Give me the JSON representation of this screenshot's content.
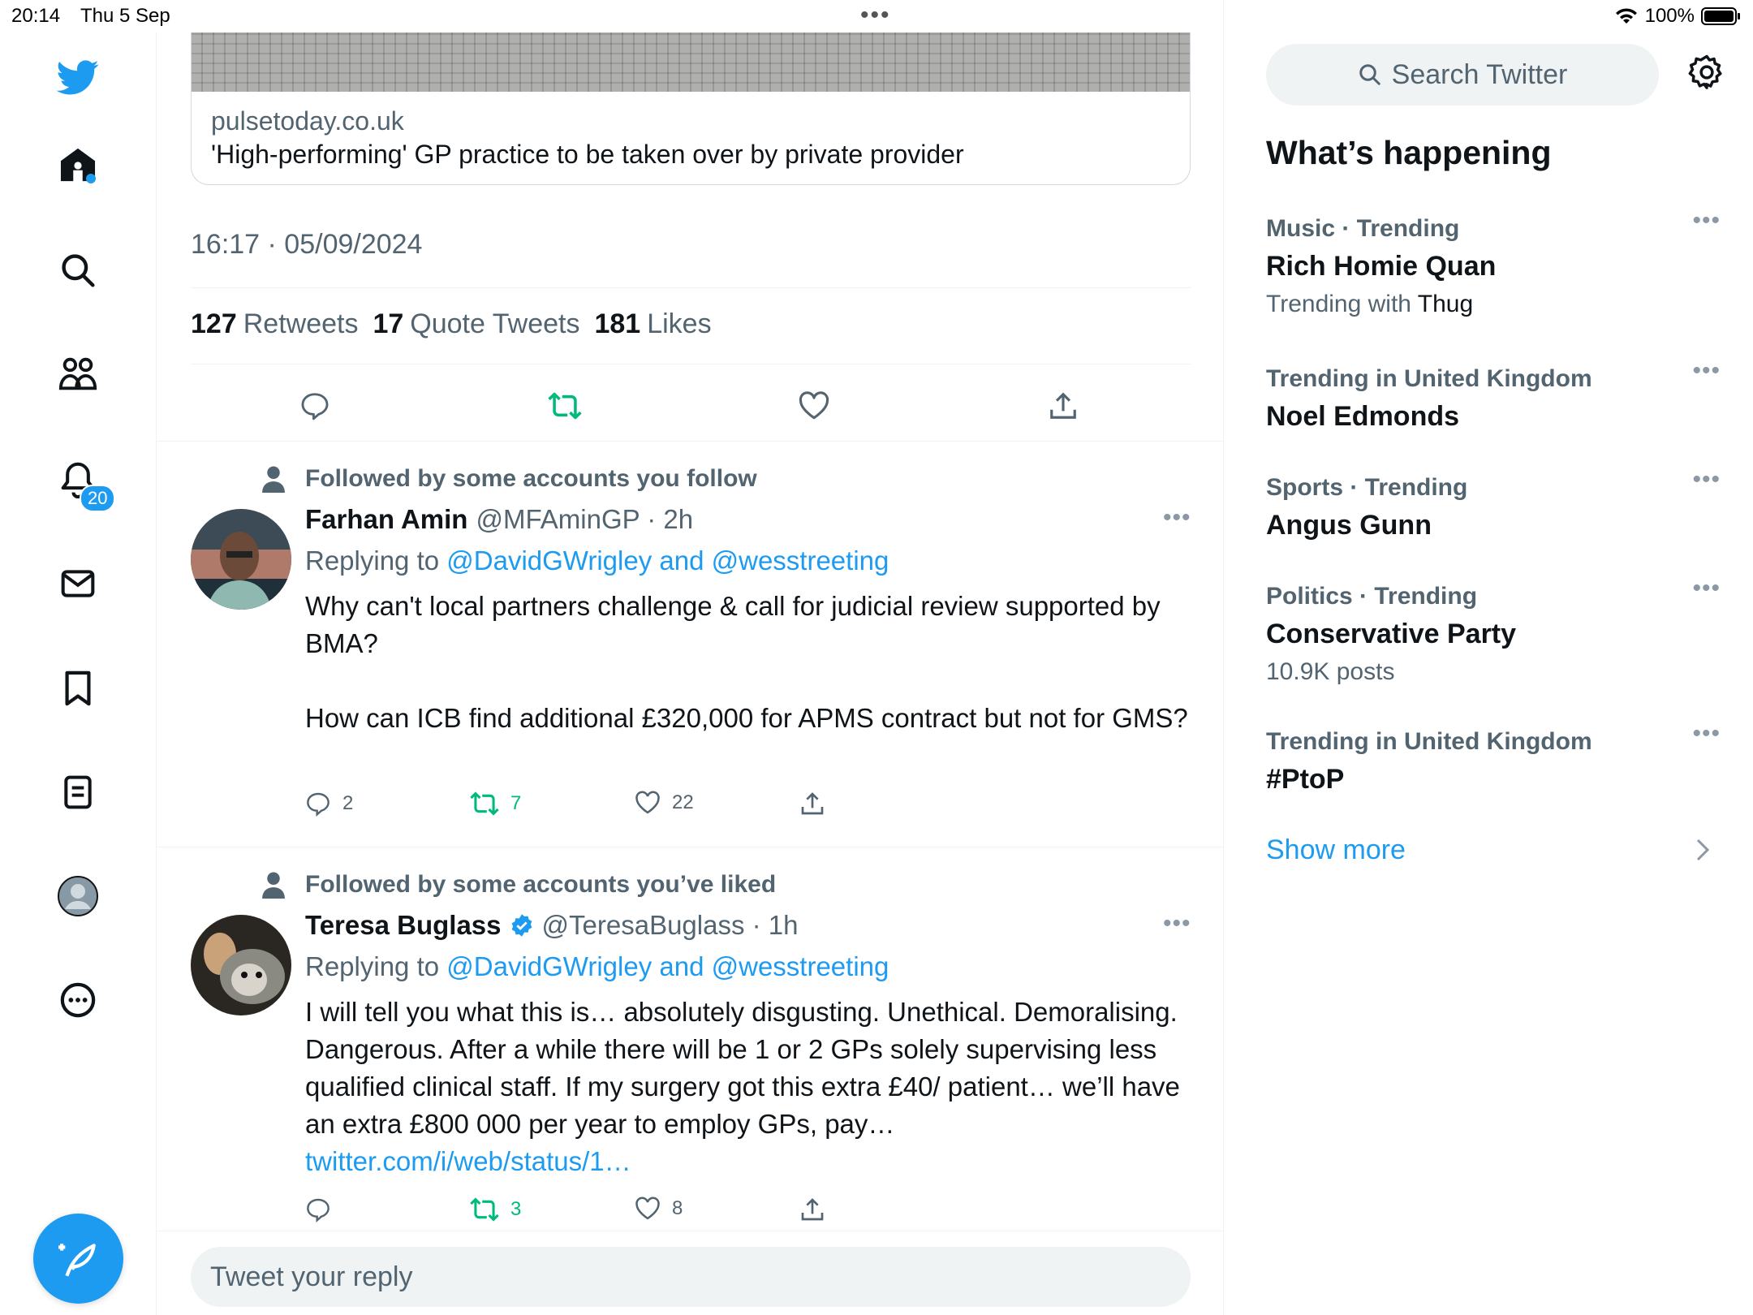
{
  "status_bar": {
    "time": "20:14",
    "date": "Thu 5 Sep",
    "battery": "100%"
  },
  "nav": {
    "notification_count": "20"
  },
  "tweet": {
    "card_domain": "pulsetoday.co.uk",
    "card_title": "'High-performing' GP practice to be taken over by private provider",
    "timestamp": "16:17 · 05/09/2024",
    "retweets_count": "127",
    "retweets_label": "Retweets",
    "quotes_count": "17",
    "quotes_label": "Quote Tweets",
    "likes_count": "181",
    "likes_label": "Likes"
  },
  "replies": [
    {
      "social_context": "Followed by some accounts you follow",
      "name": "Farhan Amin",
      "handle": "@MFAminGP · 2h",
      "replying_prefix": "Replying to ",
      "replying_to": "@DavidGWrigley and @wesstreeting",
      "text_p1": "Why can't local partners challenge & call for judicial review supported by BMA?",
      "text_p2": "How can ICB find additional £320,000 for APMS contract but not for GMS?",
      "replies": "2",
      "retweets": "7",
      "likes": "22"
    },
    {
      "social_context": "Followed by some accounts you’ve liked",
      "name": "Teresa Buglass",
      "handle": "@TeresaBuglass · 1h",
      "replying_prefix": "Replying to ",
      "replying_to": "@DavidGWrigley and @wesstreeting",
      "text": "I will tell you what this is… absolutely disgusting. Unethical. Demoralising. Dangerous. After a while there will be 1 or 2 GPs solely supervising less qualified clinical staff. If my surgery got this extra £40/ patient… we’ll have an extra £800 000 per year to employ GPs, pay…",
      "link": "twitter.com/i/web/status/1…",
      "retweets": "3",
      "likes": "8"
    }
  ],
  "reply_box": {
    "placeholder": "Tweet your reply"
  },
  "sidebar": {
    "search_placeholder": "Search Twitter",
    "heading": "What’s happening",
    "trends": [
      {
        "context": "Music · Trending",
        "title": "Rich Homie Quan",
        "sub_prefix": "Trending with ",
        "sub_value": "Thug"
      },
      {
        "context": "Trending in United Kingdom",
        "title": "Noel Edmonds"
      },
      {
        "context": "Sports · Trending",
        "title": "Angus Gunn"
      },
      {
        "context": "Politics · Trending",
        "title": "Conservative Party",
        "sub": "10.9K posts"
      },
      {
        "context": "Trending in United Kingdom",
        "title": "#PtoP"
      }
    ],
    "show_more": "Show more"
  },
  "colors": {
    "accent": "#1d9bf0",
    "retweet": "#00ba7c",
    "muted": "#536471"
  }
}
